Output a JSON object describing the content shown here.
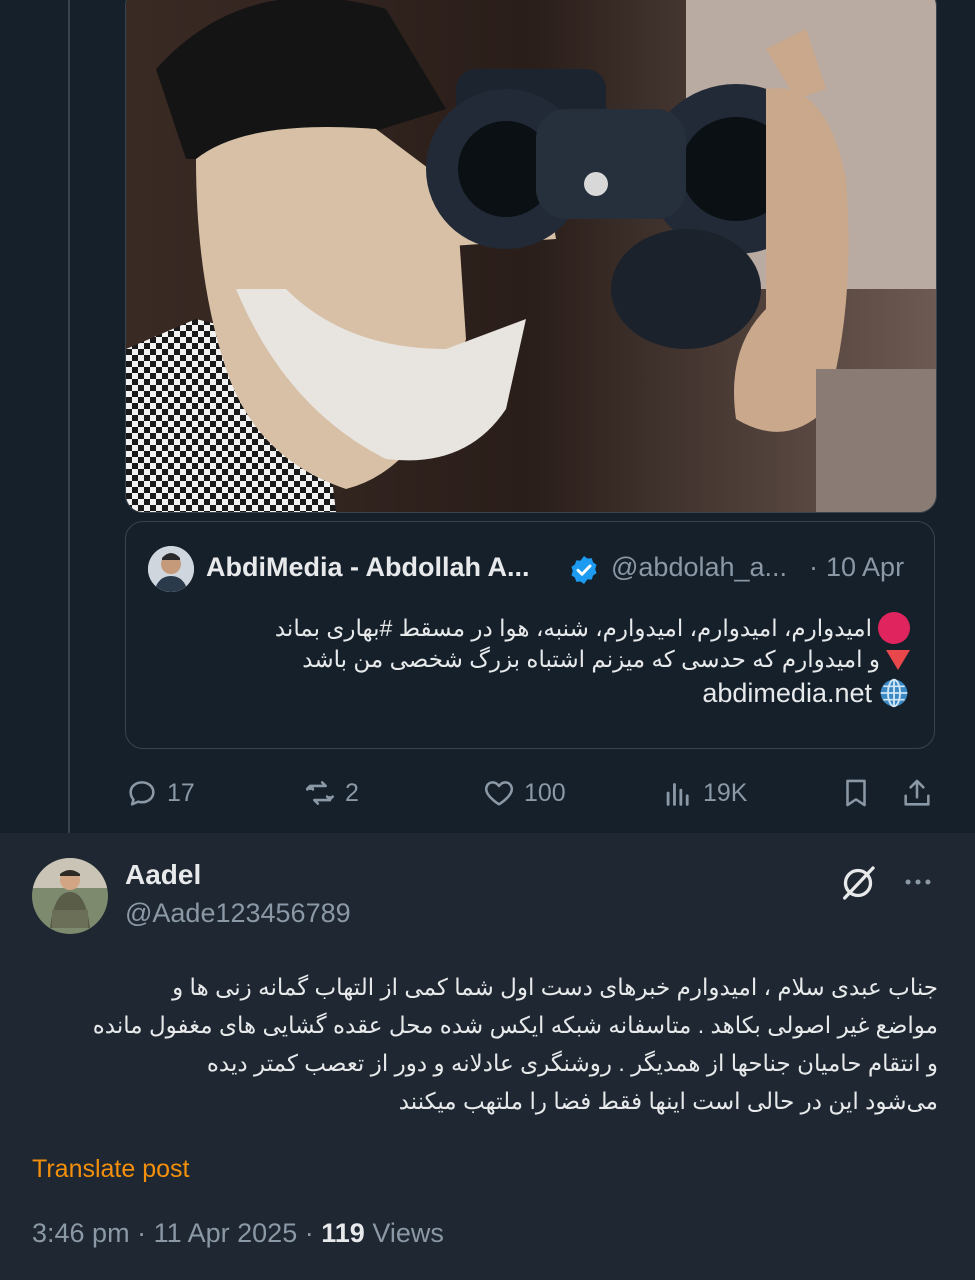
{
  "quoted_tweet": {
    "author_name": "AbdiMedia - Abdollah A...",
    "handle": "@abdolah_a...",
    "separator": "·",
    "date": "10 Apr",
    "lines": [
      "امیدوارم، امیدوارم، امیدوارم، شنبه، هوا در مسقط #بهاری بماند",
      "و امیدوارم که حدسی که میزنم اشتباه بزرگ شخصی من باشد"
    ],
    "link": "abdimedia.net"
  },
  "actions": {
    "replies": "17",
    "reposts": "2",
    "likes": "100",
    "views": "19K"
  },
  "reply_tweet": {
    "author_name": "Aadel",
    "handle": "@Aade123456789",
    "lines": [
      "جناب عبدی سلام ، امیدوارم خبرهای دست اول شما کمی از التهاب گمانه زنی ها و",
      "مواضع غیر اصولی بکاهد . متاسفانه شبکه ایکس شده محل عقده گشایی های مغفول مانده",
      "و انتقام حامیان جناحها از همدیگر . روشنگری عادلانه و دور از تعصب کمتر دیده",
      "می‌شود این در حالی است اینها فقط فضا را ملتهب میکنند"
    ],
    "translate_label": "Translate post",
    "time": "3:46 pm",
    "date": "11 Apr 2025",
    "separator": "·",
    "views_count": "119",
    "views_label": "Views"
  },
  "colors": {
    "background": "#15202b",
    "reply_background": "#1e2732",
    "secondary_text": "#8b98a5",
    "verified_blue": "#1d9bf0",
    "translate_orange": "#f4900c"
  },
  "icons": [
    "reply-icon",
    "repost-icon",
    "like-icon",
    "views-icon",
    "bookmark-icon",
    "share-icon",
    "grok-icon",
    "more-icon",
    "globe-icon",
    "verified-icon"
  ]
}
